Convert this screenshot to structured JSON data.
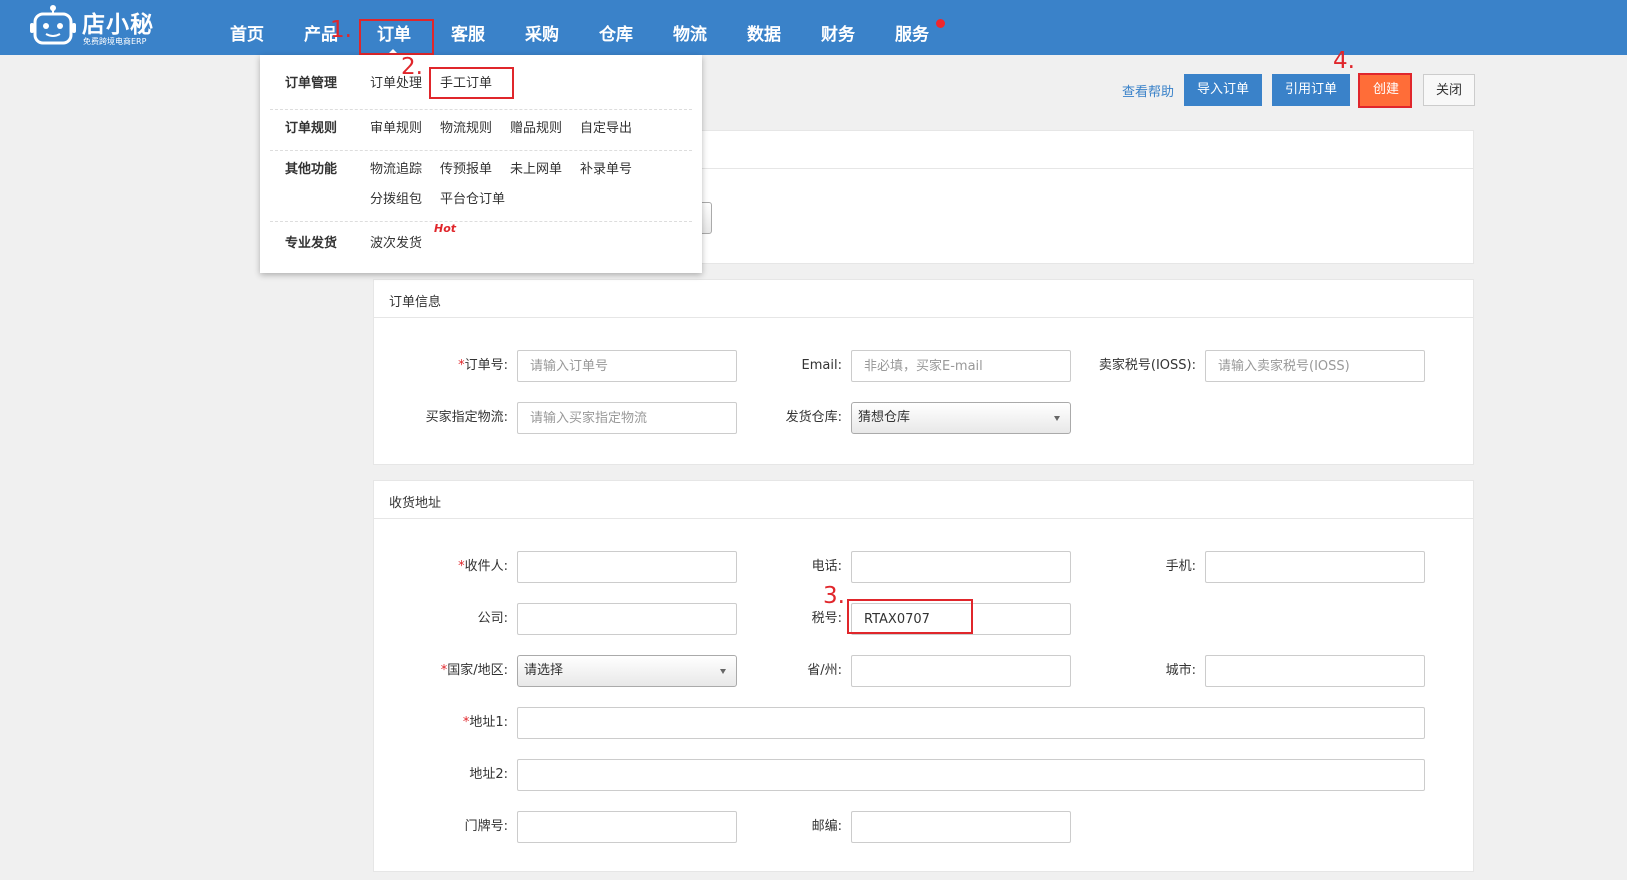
{
  "brand": {
    "name": "店小秘",
    "tagline": "免费跨境电商ERP"
  },
  "nav": {
    "items": [
      "首页",
      "产品",
      "订单",
      "客服",
      "采购",
      "仓库",
      "物流",
      "数据",
      "财务",
      "服务"
    ],
    "active": "订单"
  },
  "annotations": [
    "1.",
    "2.",
    "3.",
    "4."
  ],
  "dropdown": {
    "groups": [
      {
        "label": "订单管理",
        "links": [
          "订单处理",
          "手工订单"
        ]
      },
      {
        "label": "订单规则",
        "links": [
          "审单规则",
          "物流规则",
          "赠品规则",
          "自定导出"
        ]
      },
      {
        "label": "其他功能",
        "links": [
          "物流追踪",
          "传预报单",
          "未上网单",
          "补录单号",
          "分拨组包",
          "平台仓订单"
        ]
      },
      {
        "label": "专业发货",
        "links": [
          "波次发货"
        ]
      }
    ],
    "hot_badge": "Hot"
  },
  "header": {
    "help_link": "查看帮助",
    "import_button": "导入订单",
    "quote_button": "引用订单",
    "create_button": "创建",
    "close_button": "关闭"
  },
  "order_info": {
    "title": "订单信息",
    "order_no": {
      "required_mark": "*",
      "label": "订单号:",
      "placeholder": "请输入订单号"
    },
    "email": {
      "label": "Email:",
      "placeholder": "非必填，买家E-mail"
    },
    "ioss": {
      "label": "卖家税号(IOSS):",
      "placeholder": "请输入卖家税号(IOSS)"
    },
    "buyer_logistics": {
      "label": "买家指定物流:",
      "placeholder": "请输入买家指定物流"
    },
    "warehouse": {
      "label": "发货仓库:",
      "value": "猜想仓库"
    }
  },
  "shipping": {
    "title": "收货地址",
    "recipient": {
      "required_mark": "*",
      "label": "收件人:"
    },
    "phone": {
      "label": "电话:"
    },
    "mobile": {
      "label": "手机:"
    },
    "company": {
      "label": "公司:"
    },
    "tax_no": {
      "label": "税号:",
      "value": "RTAX0707"
    },
    "country": {
      "required_mark": "*",
      "label": "国家/地区:",
      "value": "请选择"
    },
    "province": {
      "label": "省/州:"
    },
    "city": {
      "label": "城市:"
    },
    "address1": {
      "required_mark": "*",
      "label": "地址1:"
    },
    "address2": {
      "label": "地址2:"
    },
    "house_no": {
      "label": "门牌号:"
    },
    "postcode": {
      "label": "邮编:"
    }
  },
  "colors": {
    "topbar": "#3a82c9",
    "primary_button": "#3a82c9",
    "create_button": "#ff6d38",
    "annotation": "#e0262b",
    "page_background": "#f0f0f0"
  }
}
